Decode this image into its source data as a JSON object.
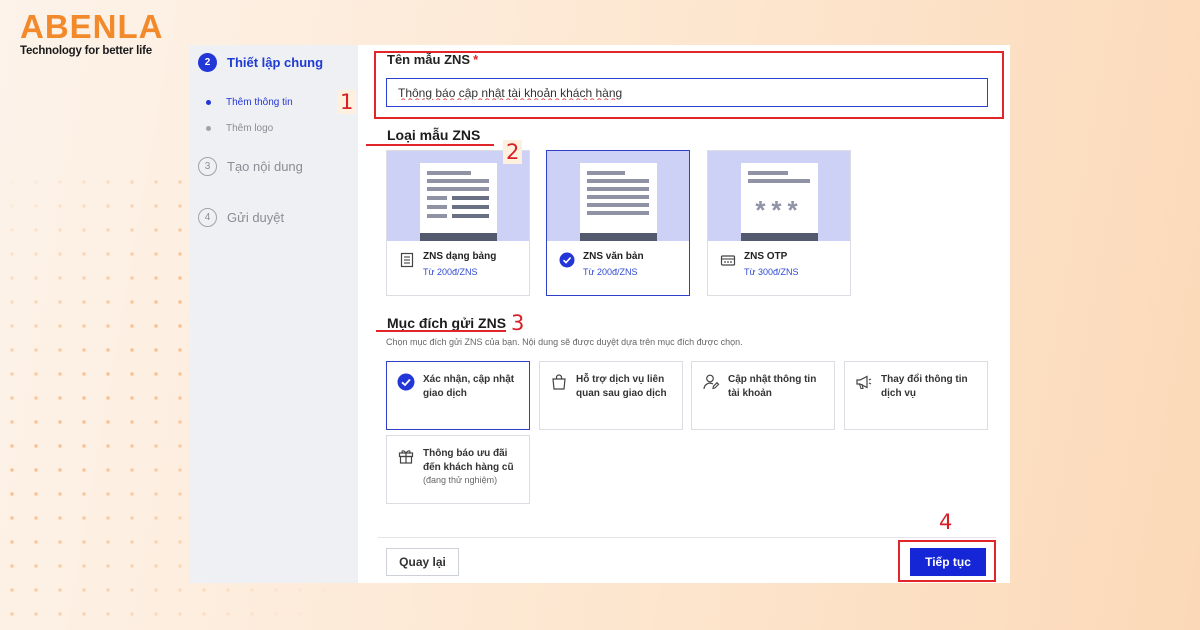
{
  "brand": {
    "name": "ABENLA",
    "tagline": "Technology for better life"
  },
  "sidebar": {
    "steps": [
      {
        "num": "2",
        "label": "Thiết lập chung",
        "state": "active"
      },
      {
        "num": "3",
        "label": "Tạo nội dung",
        "state": "inactive"
      },
      {
        "num": "4",
        "label": "Gửi duyệt",
        "state": "inactive"
      }
    ],
    "substeps": [
      {
        "label": "Thêm thông tin",
        "state": "active"
      },
      {
        "label": "Thêm logo",
        "state": "inactive"
      }
    ]
  },
  "form": {
    "name_label": "Tên mẫu ZNS",
    "required_mark": "*",
    "name_value": "Thông báo cập nhật tài khoản khách hàng",
    "type_title": "Loại mẫu ZNS",
    "types": [
      {
        "name": "ZNS dạng bảng",
        "price": "Từ 200đ/ZNS",
        "icon": "table-doc-icon",
        "selected": false
      },
      {
        "name": "ZNS văn bản",
        "price": "Từ 200đ/ZNS",
        "icon": "check-circle-icon",
        "selected": true
      },
      {
        "name": "ZNS OTP",
        "price": "Từ 300đ/ZNS",
        "icon": "otp-icon",
        "selected": false
      }
    ],
    "otp_mask": "***",
    "purpose_title": "Mục đích gửi ZNS",
    "purpose_desc": "Chọn mục đích gửi ZNS của bạn. Nội dung sẽ được duyệt dựa trên mục đích được chọn.",
    "purposes": [
      {
        "label": "Xác nhận, cập nhật giao dịch",
        "icon": "check-circle-icon",
        "selected": true
      },
      {
        "label": "Hỗ trợ dịch vụ liên quan sau giao dịch",
        "icon": "shopping-bag-icon",
        "selected": false
      },
      {
        "label": "Cập nhật thông tin tài khoản",
        "icon": "user-edit-icon",
        "selected": false
      },
      {
        "label": "Thay đổi thông tin dịch vụ",
        "icon": "megaphone-icon",
        "selected": false
      },
      {
        "label": "Thông báo ưu đãi đến khách hàng cũ",
        "sub": "(đang thử nghiệm)",
        "icon": "gift-icon",
        "selected": false
      }
    ]
  },
  "actions": {
    "back_label": "Quay lại",
    "next_label": "Tiếp tục"
  },
  "annotations": [
    "1",
    "2",
    "3",
    "4"
  ],
  "colors": {
    "brand_orange": "#f28a2c",
    "primary_blue": "#1426d6",
    "annotation_red": "#e2242b",
    "card_bg": "#cdd1f6"
  }
}
